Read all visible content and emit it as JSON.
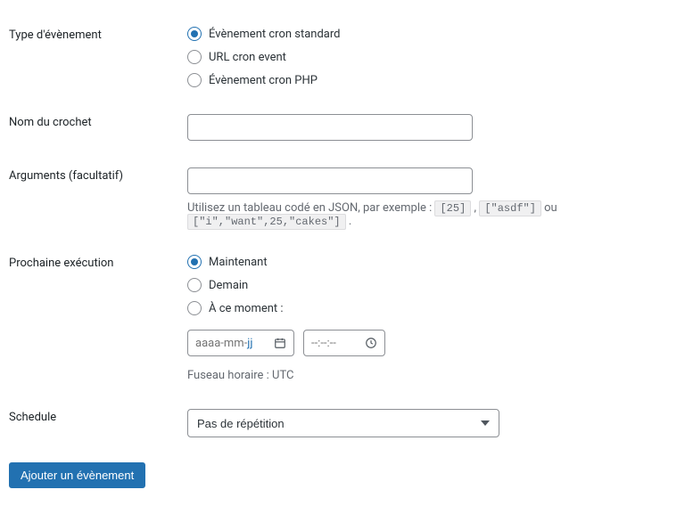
{
  "fields": {
    "event_type": {
      "label": "Type d'évènement",
      "options": [
        {
          "label": "Évènement cron standard",
          "checked": true
        },
        {
          "label": "URL cron event",
          "checked": false
        },
        {
          "label": "Évènement cron PHP",
          "checked": false
        }
      ]
    },
    "hook_name": {
      "label": "Nom du crochet",
      "value": ""
    },
    "arguments": {
      "label": "Arguments (facultatif)",
      "value": "",
      "help_prefix": "Utilisez un tableau codé en JSON, par exemple : ",
      "examples": [
        "[25]",
        "[\"asdf\"]",
        "[\"i\",\"want\",25,\"cakes\"]"
      ],
      "sep": " , ",
      "or": " ou ",
      "trail": " ."
    },
    "next_run": {
      "label": "Prochaine exécution",
      "options": [
        {
          "label": "Maintenant",
          "checked": true
        },
        {
          "label": "Demain",
          "checked": false
        },
        {
          "label": "À ce moment :",
          "checked": false
        }
      ],
      "date_placeholder_a": "aaaa",
      "date_placeholder_m": "mm",
      "date_placeholder_j": "jj",
      "time_placeholder": "--:--:--",
      "timezone": "Fuseau horaire : UTC"
    },
    "schedule": {
      "label": "Schedule",
      "selected": "Pas de répétition"
    }
  },
  "submit": {
    "label": "Ajouter un évènement"
  }
}
